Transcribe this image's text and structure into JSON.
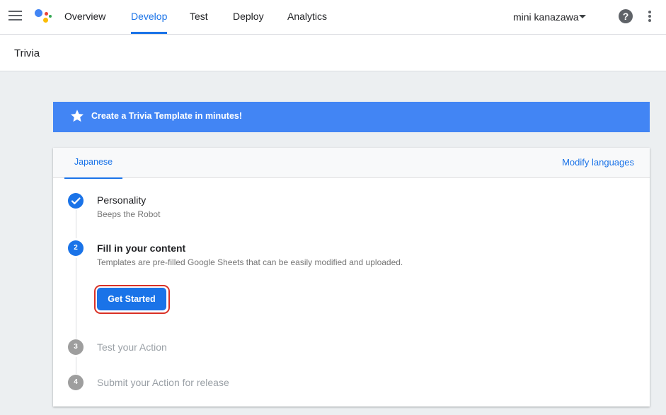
{
  "header": {
    "nav": [
      "Overview",
      "Develop",
      "Test",
      "Deploy",
      "Analytics"
    ],
    "active_tab": "Develop",
    "account_name": "mini kanazawa",
    "help_glyph": "?"
  },
  "project": {
    "title": "Trivia"
  },
  "banner": {
    "text": "Create a Trivia Template in minutes!",
    "color": "#4285f4"
  },
  "card": {
    "language_tab": "Japanese",
    "modify_languages": "Modify languages",
    "steps": [
      {
        "number": "1",
        "status": "complete",
        "title": "Personality",
        "subtitle": "Beeps the Robot"
      },
      {
        "number": "2",
        "status": "active",
        "title": "Fill in your content",
        "subtitle": "Templates are pre-filled Google Sheets that can be easily modified and uploaded."
      },
      {
        "number": "3",
        "status": "pending",
        "title": "Test your Action"
      },
      {
        "number": "4",
        "status": "pending",
        "title": "Submit your Action for release"
      }
    ],
    "cta_label": "Get Started"
  },
  "colors": {
    "accent": "#1a73e8",
    "highlight_outline": "#d93025",
    "pending_step": "#9e9e9e"
  },
  "icons": [
    "menu-icon",
    "google-assistant-logo",
    "dropdown-caret-icon",
    "help-icon",
    "more-vert-icon",
    "star-icon",
    "checkmark-icon"
  ]
}
